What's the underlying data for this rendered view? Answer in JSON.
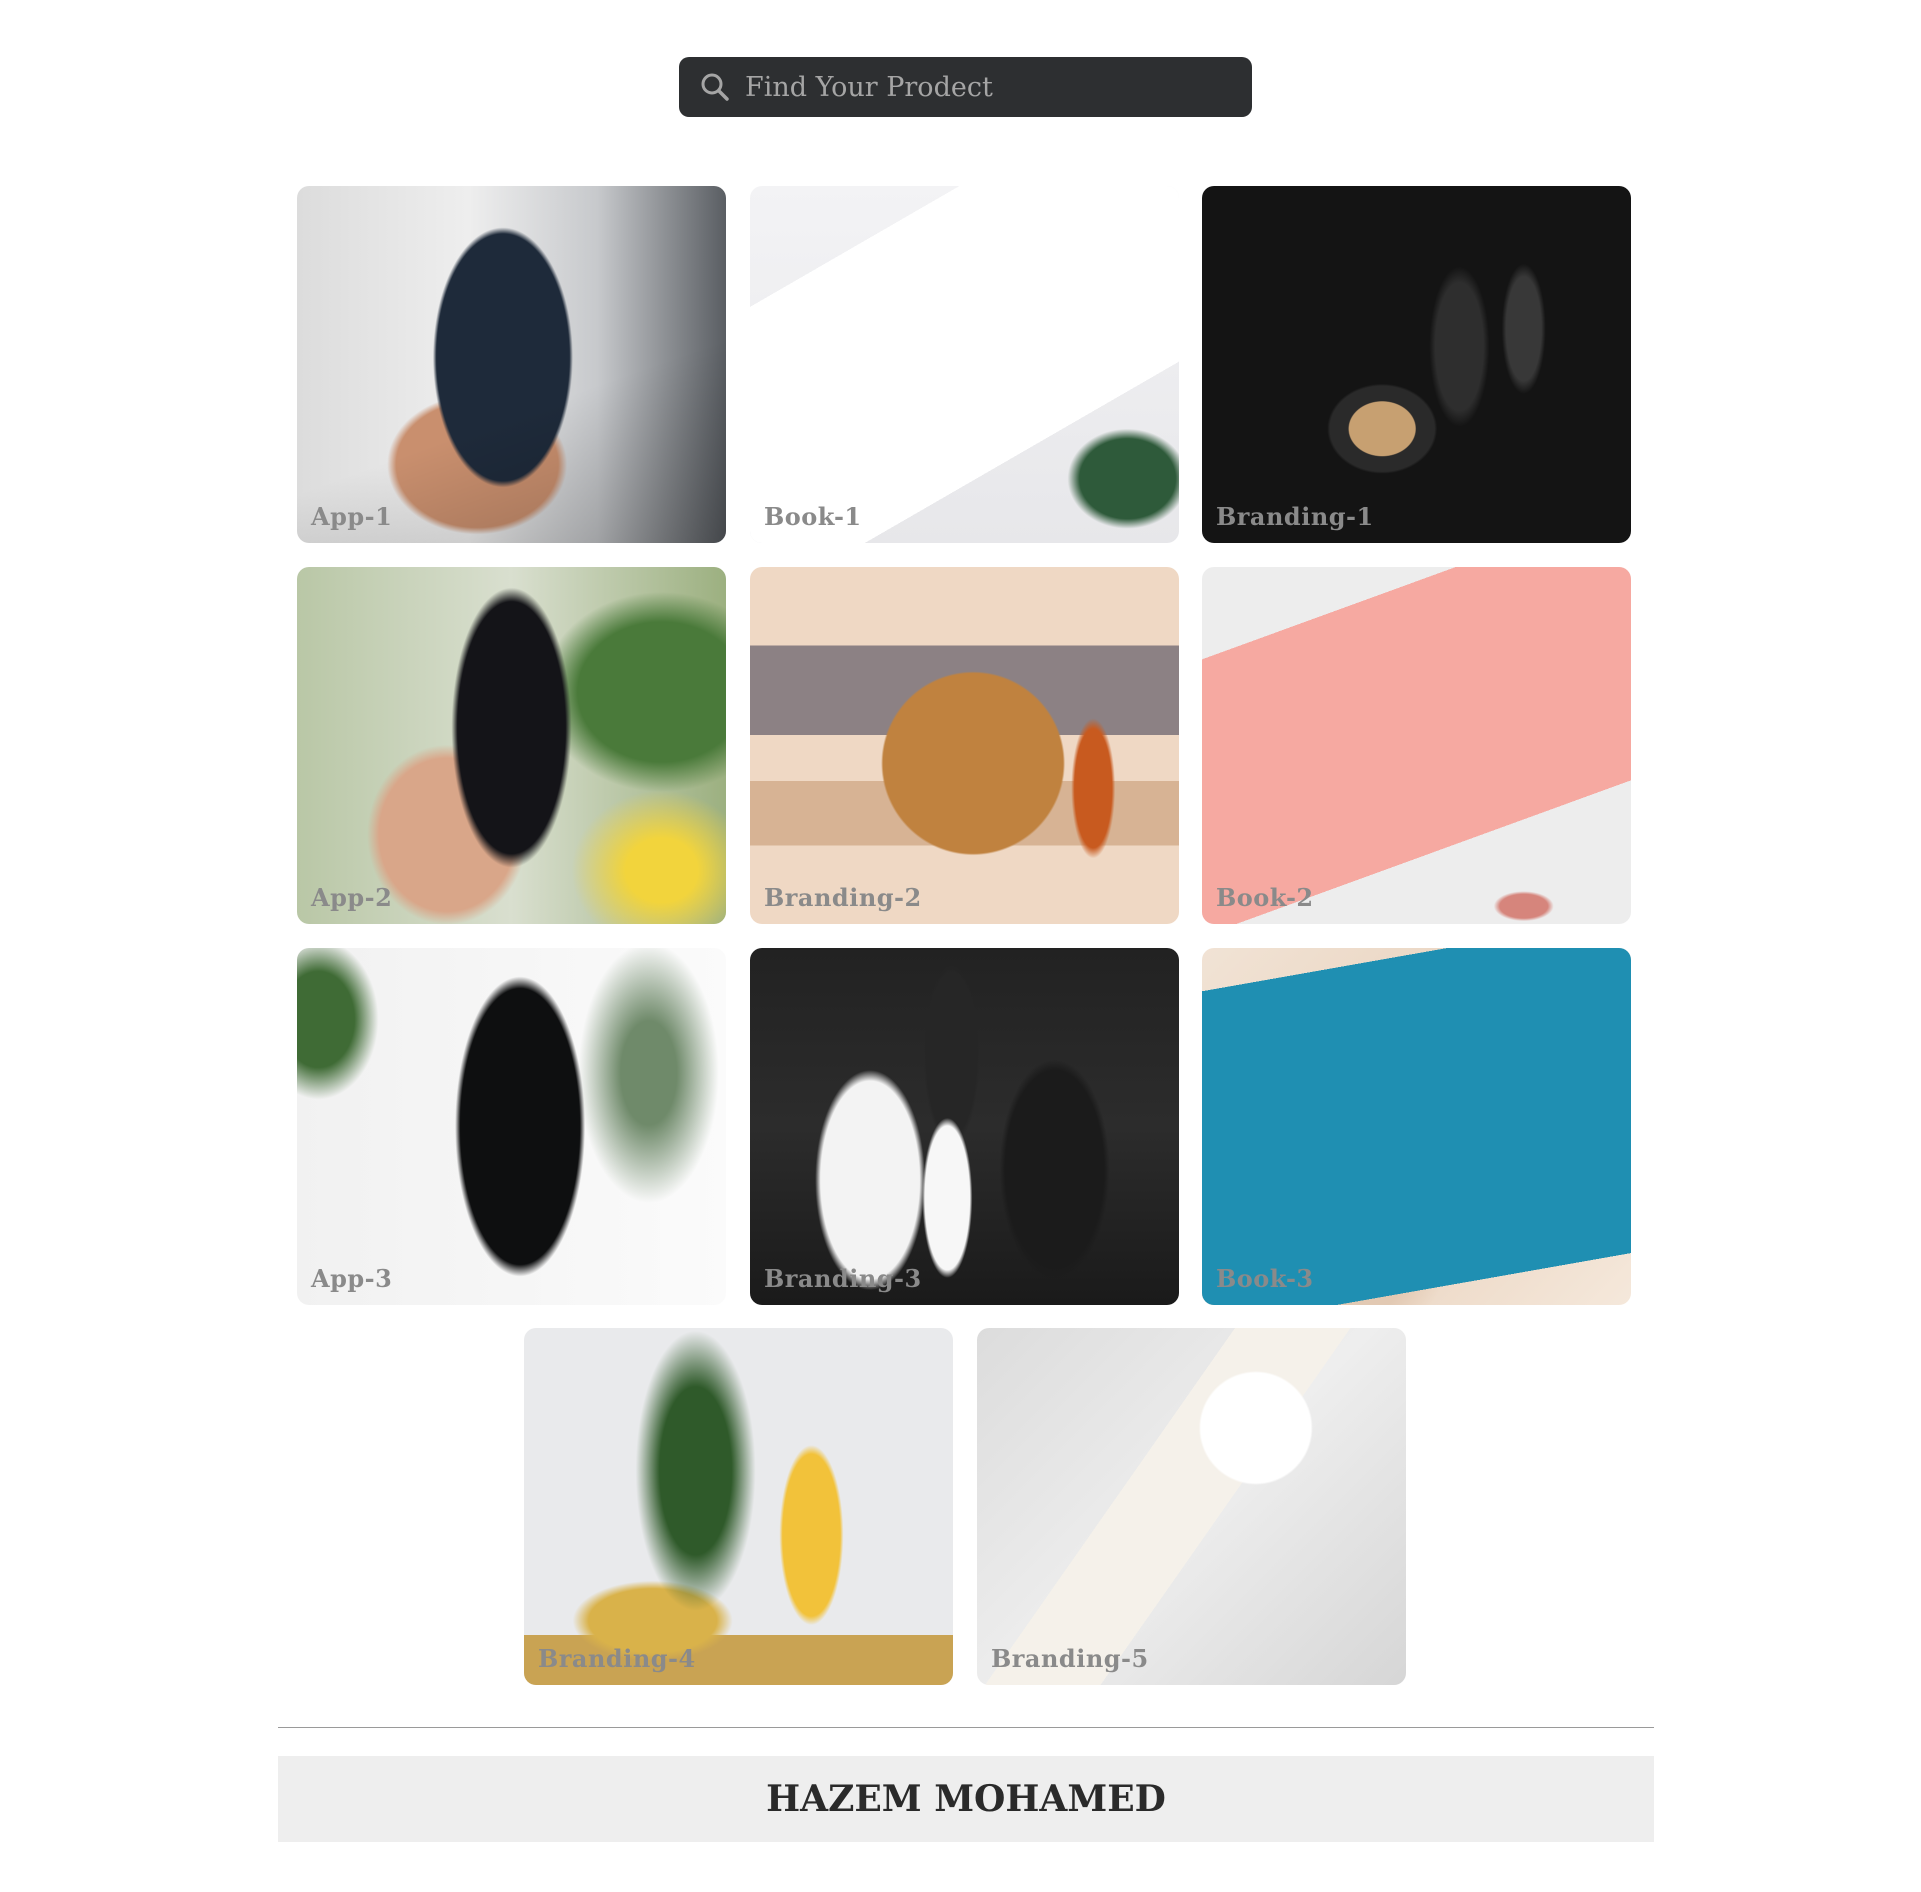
{
  "search": {
    "placeholder": "Find Your Prodect",
    "icon": "search-icon"
  },
  "products": [
    {
      "label": "App-1"
    },
    {
      "label": "Book-1"
    },
    {
      "label": "Branding-1"
    },
    {
      "label": "App-2"
    },
    {
      "label": "Branding-2"
    },
    {
      "label": "Book-2"
    },
    {
      "label": "App-3"
    },
    {
      "label": "Branding-3"
    },
    {
      "label": "Book-3"
    },
    {
      "label": "Branding-4"
    },
    {
      "label": "Branding-5"
    }
  ],
  "footer": {
    "name": "HAZEM MOHAMED"
  }
}
